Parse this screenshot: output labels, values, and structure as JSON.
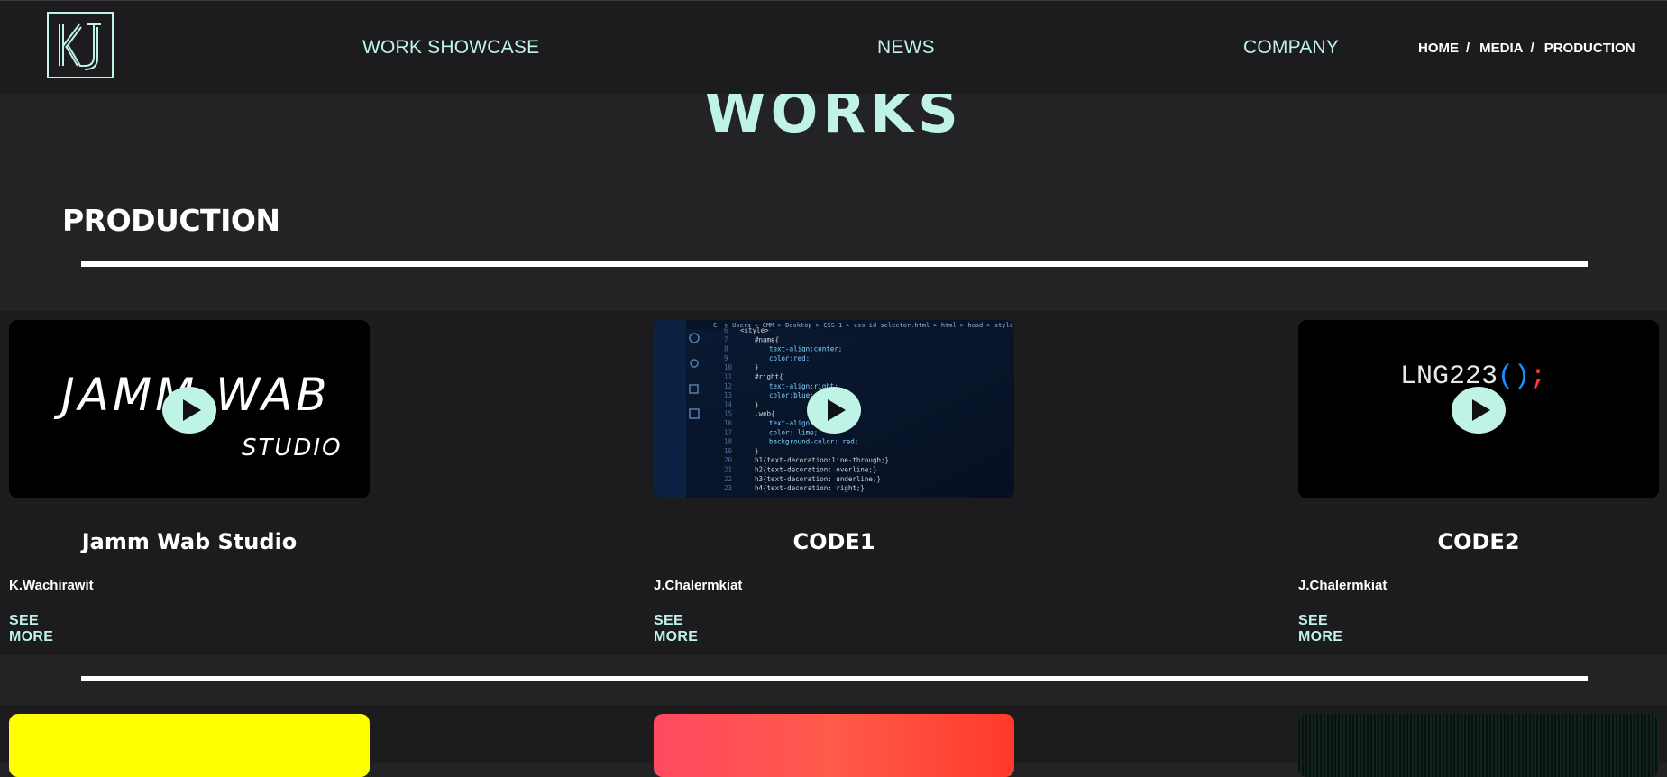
{
  "header": {
    "logo_text": "KJ",
    "nav": [
      "WORK SHOWCASE",
      "NEWS",
      "COMPANY"
    ],
    "breadcrumb": [
      "HOME",
      "MEDIA",
      "PRODUCTION"
    ],
    "breadcrumb_separator": "/"
  },
  "page_title": "WORKS",
  "section_title": "PRODUCTION",
  "works": [
    {
      "title": "Jamm Wab Studio",
      "author": "K.Wachirawit",
      "more": "SEE MORE",
      "thumb_text_1": "JAMM WAB",
      "thumb_text_2": "STUDIO"
    },
    {
      "title": "CODE1",
      "author": "J.Chalermkiat",
      "more": "SEE MORE",
      "thumb_breadcrumb": "C: > Users > CMM > Desktop > CSS-1 > css id selector.html > html > head > style"
    },
    {
      "title": "CODE2",
      "author": "J.Chalermkiat",
      "more": "SEE MORE",
      "thumb_text_main": "LNG223",
      "thumb_text_parens": "()",
      "thumb_text_semicolon": ";"
    }
  ],
  "colors": {
    "accent": "#bff3e6",
    "background": "#232326",
    "header_bg": "#1c1c1f",
    "text": "#ffffff"
  },
  "code_lines": [
    {
      "n": "6",
      "t": "<style>"
    },
    {
      "n": "7",
      "t": "#name{"
    },
    {
      "n": "8",
      "t": "text-align:center;"
    },
    {
      "n": "9",
      "t": "color:red;"
    },
    {
      "n": "10",
      "t": "}"
    },
    {
      "n": "11",
      "t": "#right{"
    },
    {
      "n": "12",
      "t": "text-align:right;"
    },
    {
      "n": "13",
      "t": "color:blue;"
    },
    {
      "n": "14",
      "t": "}"
    },
    {
      "n": "15",
      "t": ".web{"
    },
    {
      "n": "16",
      "t": "text-align:center;"
    },
    {
      "n": "17",
      "t": "color: lime;"
    },
    {
      "n": "18",
      "t": "background-color: red;"
    },
    {
      "n": "19",
      "t": "}"
    },
    {
      "n": "20",
      "t": "h1{text-decoration:line-through;}"
    },
    {
      "n": "21",
      "t": "h2{text-decoration: overline;}"
    },
    {
      "n": "22",
      "t": "h3{text-decoration: underline;}"
    },
    {
      "n": "23",
      "t": "h4{text-decoration: right;}"
    }
  ]
}
